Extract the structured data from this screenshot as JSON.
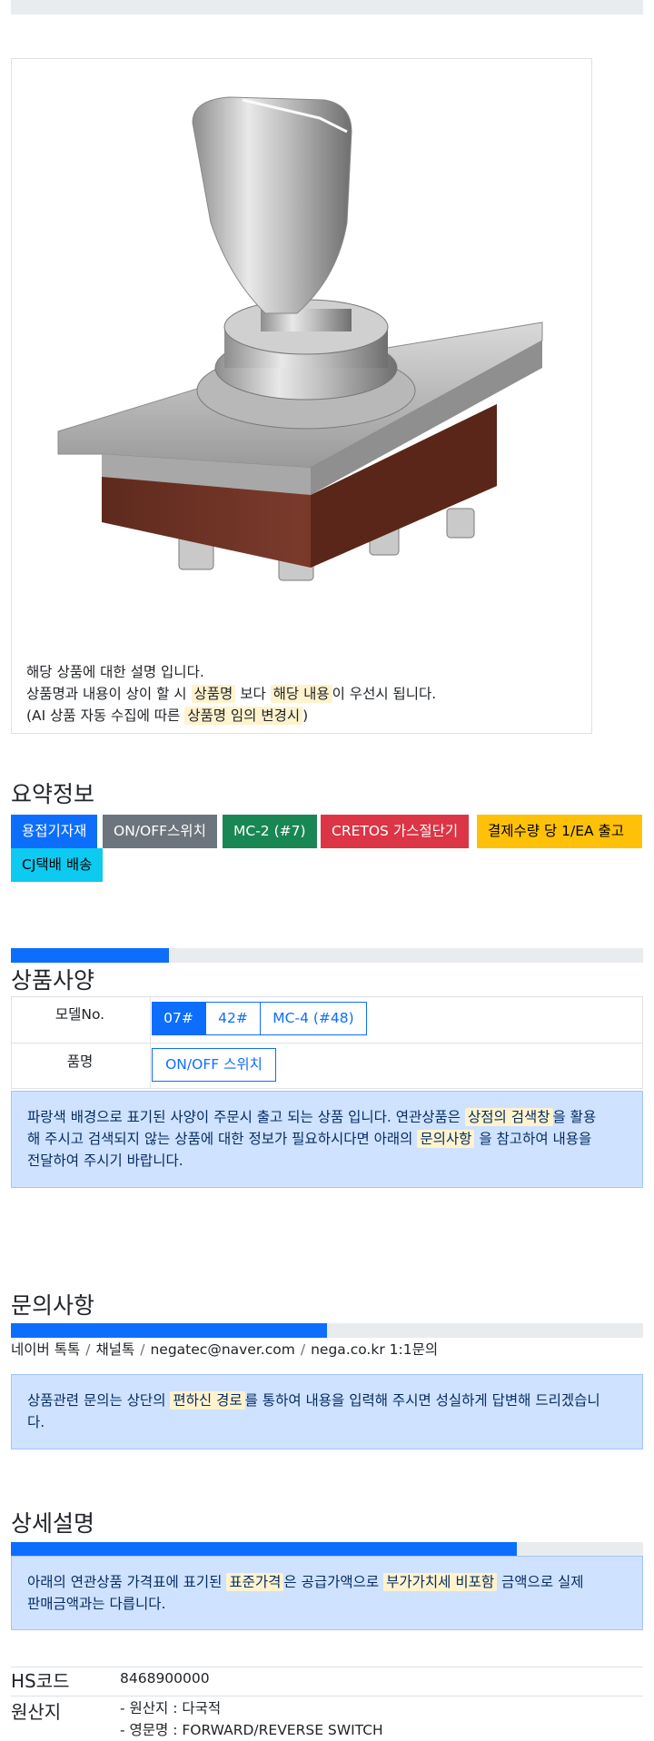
{
  "product_image": {
    "alt": "rotary key toggle switch",
    "desc_line1": "해당 상품에 대한 설명 입니다.",
    "desc_line2_a": "상품명과 내용이 상이 할 시 ",
    "desc_line2_hl1": "상품명",
    "desc_line2_b": " 보다 ",
    "desc_line2_hl2": "해당 내용",
    "desc_line2_c": "이 우선시 됩니다.",
    "desc_line3_a": "(AI 상품 자동 수집에 따른 ",
    "desc_line3_hl": "상품명 임의 변경시",
    "desc_line3_b": ")"
  },
  "summary": {
    "title": "요약정보",
    "badges": [
      {
        "label": "용접기자재",
        "bg": "#0d6efd",
        "fg": "#ffffff"
      },
      {
        "label": "ON/OFF스위치",
        "bg": "#6c757d",
        "fg": "#ffffff"
      },
      {
        "label": "MC-2 (#7)",
        "bg": "#198754",
        "fg": "#ffffff"
      },
      {
        "label": "CRETOS 가스절단기",
        "bg": "#dc3545",
        "fg": "#ffffff"
      },
      {
        "label": "결제수량 당 1/EA 출고",
        "bg": "#ffc107",
        "fg": "#000000"
      },
      {
        "label": "CJ택배 배송",
        "bg": "#0dcaf0",
        "fg": "#000000"
      }
    ]
  },
  "spec": {
    "title": "상품사양",
    "progress": 0.25,
    "model_label": "모델No.",
    "model_options": [
      {
        "label": "07#",
        "selected": true
      },
      {
        "label": "42#",
        "selected": false
      },
      {
        "label": "MC-4 (#48)",
        "selected": false
      }
    ],
    "name_label": "품명",
    "name_value": "ON/OFF 스위치",
    "notice_a": "파랑색 배경으로 표기된 사양이 주문시 출고 되는 상품 입니다. 연관상품은 ",
    "notice_hl1": "상점의 검색창",
    "notice_b": "을 활용",
    "notice_line2_a": "해 주시고 검색되지 않는 상품에 대한 정보가 필요하시다면 아래의 ",
    "notice_hl2": "문의사항",
    "notice_line2_b": " 을 참고하여 내용을",
    "notice_line3": "전달하여 주시기 바랍니다."
  },
  "inquiry": {
    "title": "문의사항",
    "progress": 0.5,
    "links": [
      "네이버 톡톡",
      "채널톡",
      "negatec@naver.com",
      "nega.co.kr 1:1문의"
    ],
    "separator": "/",
    "notice_a": "상품관련 문의는 상단의 ",
    "notice_hl": "편하신 경로",
    "notice_b": "를 통하여 내용을 입력해 주시면 성실하게 답변해 드리겠습니",
    "notice_line2": "다."
  },
  "detail": {
    "title": "상세설명",
    "progress": 0.8,
    "notice_a": "아래의 연관상품 가격표에 표기된 ",
    "notice_hl1": "표준가격",
    "notice_b": "은 공급가액으로 ",
    "notice_hl2": "부가가치세 비포함",
    "notice_c": " 금액으로 실제",
    "notice_line2": "판매금액과는 다릅니다."
  },
  "info": {
    "hs_label": "HS코드",
    "hs_value": "8468900000",
    "origin_label": "원산지",
    "origin_line1": "- 원산지 : 다국적",
    "origin_line2": "- 영문명 : FORWARD/REVERSE SWITCH"
  }
}
